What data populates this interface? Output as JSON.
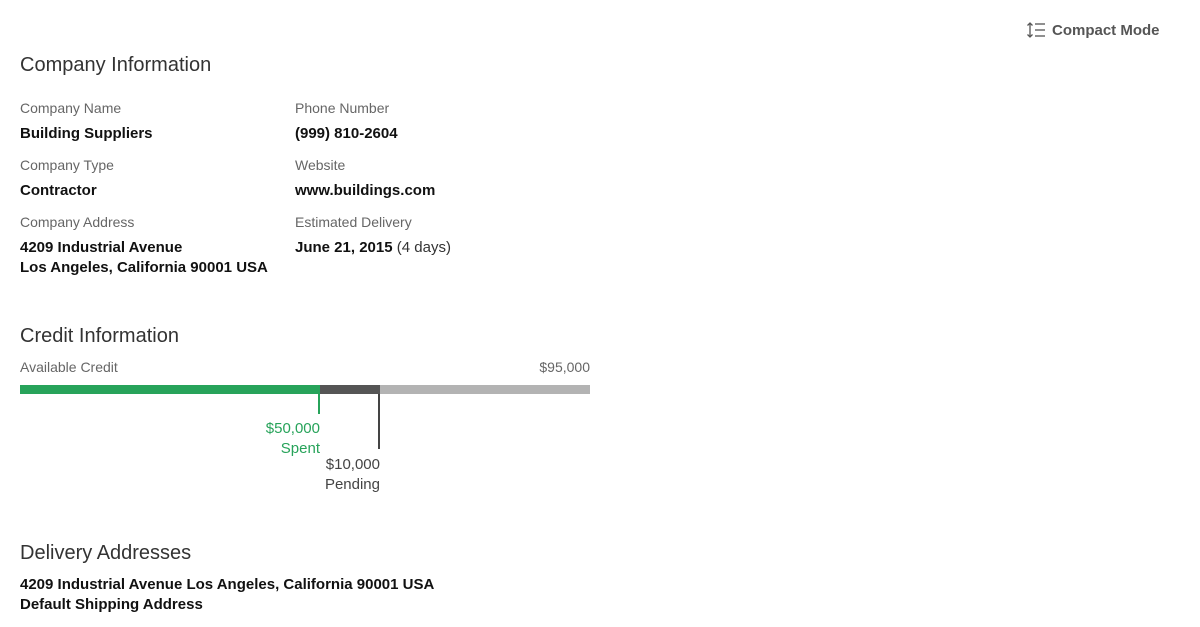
{
  "toolbar": {
    "compact_mode_label": "Compact Mode",
    "compact_mode_icon": "line-spacing-icon"
  },
  "company": {
    "title": "Company Information",
    "name_label": "Company Name",
    "name_value": "Building Suppliers",
    "type_label": "Company Type",
    "type_value": "Contractor",
    "address_label": "Company Address",
    "address_line1": "4209 Industrial Avenue",
    "address_line2": "Los Angeles, California 90001 USA",
    "phone_label": "Phone Number",
    "phone_value": "(999) 810-2604",
    "website_label": "Website",
    "website_value": "www.buildings.com",
    "delivery_label": "Estimated Delivery",
    "delivery_date": "June 21, 2015",
    "delivery_days": "(4 days)"
  },
  "credit": {
    "title": "Credit Information",
    "available_label": "Available Credit",
    "total_display": "$95,000",
    "total": 95000,
    "spent": 50000,
    "spent_display": "$50,000",
    "spent_label": "Spent",
    "pending": 10000,
    "pending_display": "$10,000",
    "pending_label": "Pending",
    "colors": {
      "spent": "#27a35a",
      "pending": "#555555",
      "remaining": "#b3b3b3"
    }
  },
  "delivery": {
    "title": "Delivery Addresses",
    "address": "4209 Industrial Avenue Los Angeles, California 90001 USA",
    "default_label": "Default Shipping Address"
  }
}
